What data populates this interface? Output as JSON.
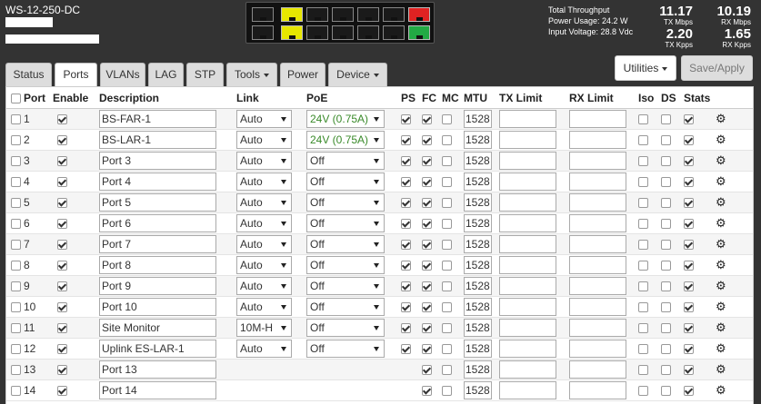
{
  "device": {
    "name": "WS-12-250-DC"
  },
  "panel": {
    "top": [
      "black",
      "yellow",
      "black",
      "black",
      "black",
      "black",
      "red"
    ],
    "bottom": [
      "black",
      "yellow",
      "black",
      "black",
      "black",
      "black",
      "green"
    ]
  },
  "stats": {
    "total_label": "Total Throughput",
    "power_label": "Power Usage: 24.2 W",
    "voltage_label": "Input Voltage: 28.8 Vdc",
    "tx_mbps": "11.17",
    "tx_mbps_unit": "TX Mbps",
    "rx_mbps": "10.19",
    "rx_mbps_unit": "RX Mbps",
    "tx_kpps": "2.20",
    "tx_kpps_unit": "TX Kpps",
    "rx_kpps": "1.65",
    "rx_kpps_unit": "RX Kpps"
  },
  "tabs": [
    "Status",
    "Ports",
    "VLANs",
    "LAG",
    "STP",
    "Tools",
    "Power",
    "Device"
  ],
  "buttons": {
    "utilities": "Utilities",
    "save": "Save/Apply"
  },
  "columns": [
    "Port",
    "Enable",
    "Description",
    "Link",
    "PoE",
    "PS",
    "FC",
    "MC",
    "MTU",
    "TX Limit",
    "RX Limit",
    "Iso",
    "DS",
    "Stats"
  ],
  "ports": [
    {
      "port": "1",
      "enable": true,
      "desc": "BS-FAR-1",
      "link": "Auto",
      "poe": "24V (0.75A)",
      "ps": true,
      "fc": true,
      "mc": false,
      "mtu": "1528",
      "iso": false,
      "ds": false,
      "stats": true
    },
    {
      "port": "2",
      "enable": true,
      "desc": "BS-LAR-1",
      "link": "Auto",
      "poe": "24V (0.75A)",
      "ps": true,
      "fc": true,
      "mc": false,
      "mtu": "1528",
      "iso": false,
      "ds": false,
      "stats": true
    },
    {
      "port": "3",
      "enable": true,
      "desc": "Port 3",
      "link": "Auto",
      "poe": "Off",
      "ps": true,
      "fc": true,
      "mc": false,
      "mtu": "1528",
      "iso": false,
      "ds": false,
      "stats": true
    },
    {
      "port": "4",
      "enable": true,
      "desc": "Port 4",
      "link": "Auto",
      "poe": "Off",
      "ps": true,
      "fc": true,
      "mc": false,
      "mtu": "1528",
      "iso": false,
      "ds": false,
      "stats": true
    },
    {
      "port": "5",
      "enable": true,
      "desc": "Port 5",
      "link": "Auto",
      "poe": "Off",
      "ps": true,
      "fc": true,
      "mc": false,
      "mtu": "1528",
      "iso": false,
      "ds": false,
      "stats": true
    },
    {
      "port": "6",
      "enable": true,
      "desc": "Port 6",
      "link": "Auto",
      "poe": "Off",
      "ps": true,
      "fc": true,
      "mc": false,
      "mtu": "1528",
      "iso": false,
      "ds": false,
      "stats": true
    },
    {
      "port": "7",
      "enable": true,
      "desc": "Port 7",
      "link": "Auto",
      "poe": "Off",
      "ps": true,
      "fc": true,
      "mc": false,
      "mtu": "1528",
      "iso": false,
      "ds": false,
      "stats": true
    },
    {
      "port": "8",
      "enable": true,
      "desc": "Port 8",
      "link": "Auto",
      "poe": "Off",
      "ps": true,
      "fc": true,
      "mc": false,
      "mtu": "1528",
      "iso": false,
      "ds": false,
      "stats": true
    },
    {
      "port": "9",
      "enable": true,
      "desc": "Port 9",
      "link": "Auto",
      "poe": "Off",
      "ps": true,
      "fc": true,
      "mc": false,
      "mtu": "1528",
      "iso": false,
      "ds": false,
      "stats": true
    },
    {
      "port": "10",
      "enable": true,
      "desc": "Port 10",
      "link": "Auto",
      "poe": "Off",
      "ps": true,
      "fc": true,
      "mc": false,
      "mtu": "1528",
      "iso": false,
      "ds": false,
      "stats": true
    },
    {
      "port": "11",
      "enable": true,
      "desc": "Site Monitor",
      "link": "10M-H",
      "poe": "Off",
      "ps": true,
      "fc": true,
      "mc": false,
      "mtu": "1528",
      "iso": false,
      "ds": false,
      "stats": true
    },
    {
      "port": "12",
      "enable": true,
      "desc": "Uplink ES-LAR-1",
      "link": "Auto",
      "poe": "Off",
      "ps": true,
      "fc": true,
      "mc": false,
      "mtu": "1528",
      "iso": false,
      "ds": false,
      "stats": true
    },
    {
      "port": "13",
      "enable": true,
      "desc": "Port 13",
      "link": null,
      "poe": null,
      "ps": null,
      "fc": true,
      "mc": false,
      "mtu": "1528",
      "iso": false,
      "ds": false,
      "stats": true
    },
    {
      "port": "14",
      "enable": true,
      "desc": "Port 14",
      "link": null,
      "poe": null,
      "ps": null,
      "fc": true,
      "mc": false,
      "mtu": "1528",
      "iso": false,
      "ds": false,
      "stats": true
    }
  ]
}
